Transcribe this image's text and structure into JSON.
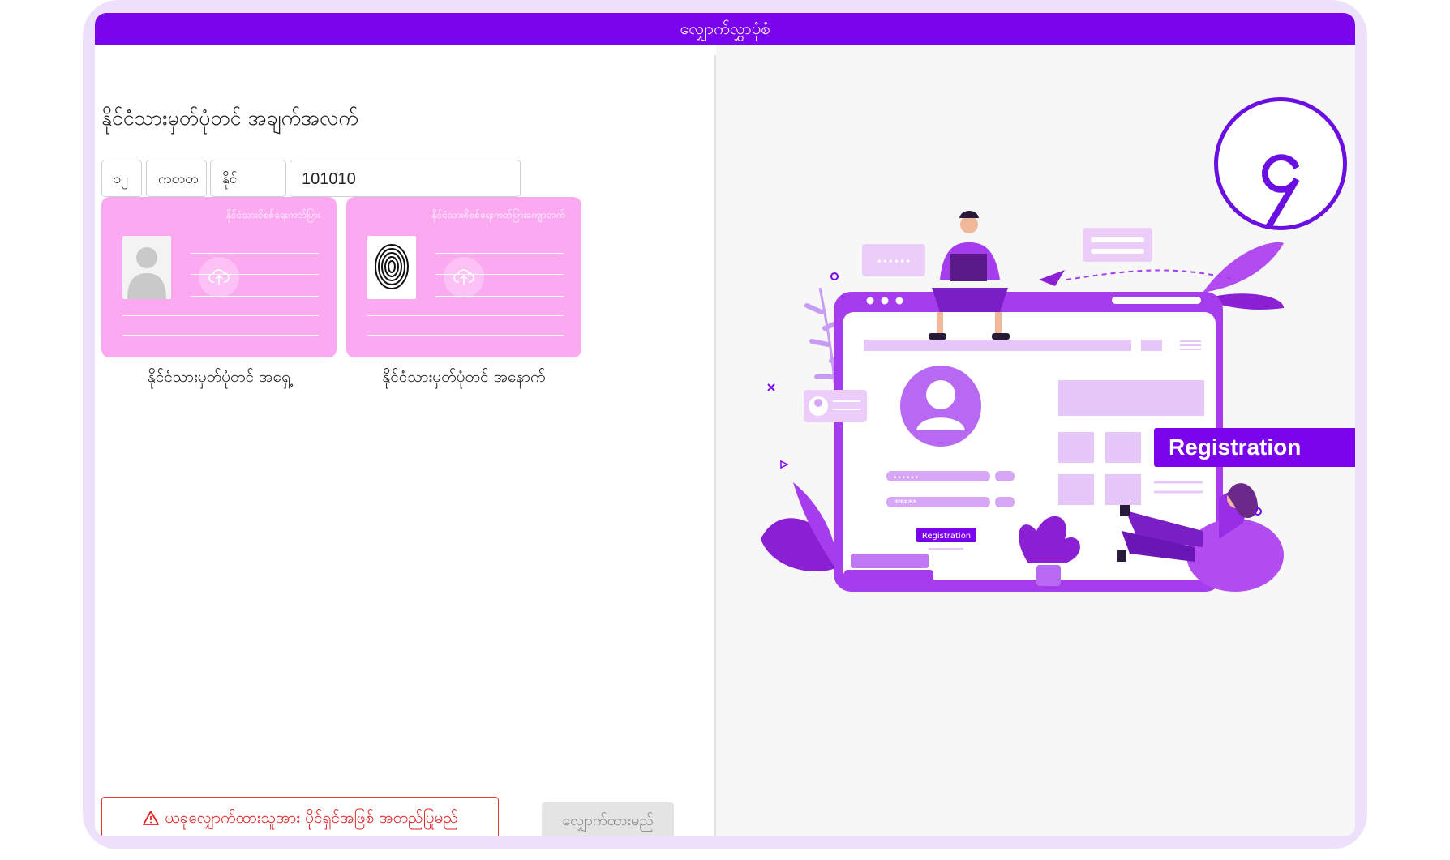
{
  "form": {
    "title": "လျှောက်လွှာပုံစံ"
  },
  "nrc": {
    "section_title": "နိုင်ငံသားမှတ်ပုံတင် အချက်အလက်",
    "state": "၁၂",
    "township": "ကတတ",
    "type": "နိုင်",
    "number": "101010"
  },
  "id_front": {
    "card_header": "နိုင်ငံသားစိစစ်ရေးကတ်ပြား",
    "label": "နိုင်ငံသားမှတ်ပုံတင် အရှေ့"
  },
  "id_back": {
    "card_header": "နိုင်ငံသားစိစစ်ရေးကတ်ပြားကျောဘက်",
    "label": "နိုင်ငံသားမှတ်ပုံတင် အနောက်"
  },
  "actions": {
    "warning_label": "ယခုလျှောက်ထားသူအား ပိုင်ရှင်အဖြစ် အတည်ပြုမည်",
    "submit_label": "လျှောက်ထားမည်"
  },
  "step": {
    "number": "၄"
  },
  "illustration": {
    "banner": "Registration",
    "small_button": "Registration",
    "password_dots": "••••••",
    "password_stars": "*****"
  },
  "colors": {
    "accent": "#7a05ec",
    "card_pink": "#fbaaf2",
    "illustration_purple": "#a53ded",
    "warning_red": "#e02020"
  }
}
